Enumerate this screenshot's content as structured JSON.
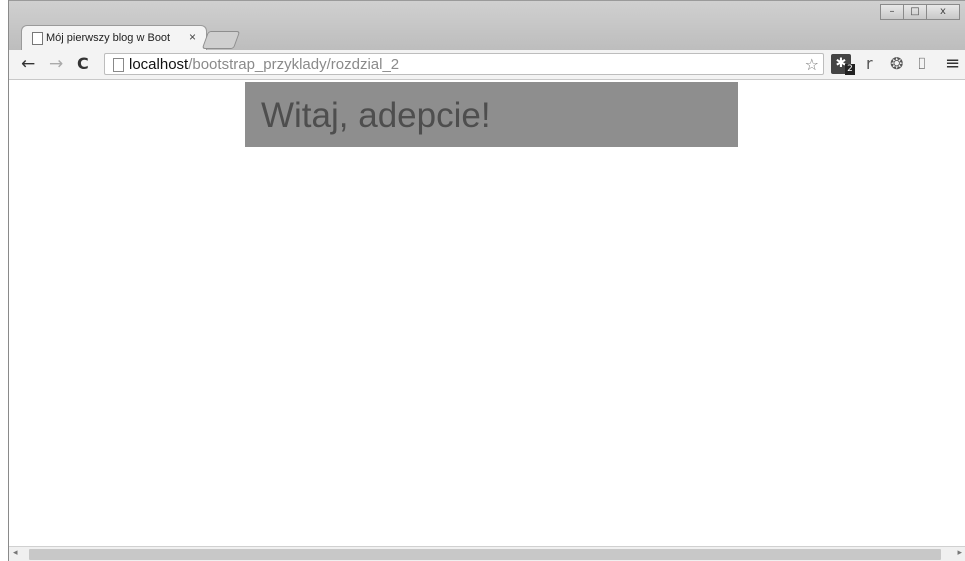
{
  "window": {
    "controls": {
      "minimize": "–",
      "maximize": "□",
      "close": "x"
    }
  },
  "tabs": [
    {
      "title": "Mój pierwszy blog w Boot",
      "close": "×",
      "icon": "page-icon"
    }
  ],
  "toolbar": {
    "back": "←",
    "forward": "→",
    "reload": "C",
    "url_host": "localhost",
    "url_path": "/bootstrap_przyklady/rozdzial_2",
    "bookmark_star": "☆",
    "extensions": [
      {
        "name": "extension-badge-icon",
        "glyph": "✱",
        "badge": "2"
      },
      {
        "name": "r-extension-icon",
        "glyph": "r"
      },
      {
        "name": "chrome-extension-icon",
        "glyph": "❂"
      },
      {
        "name": "cast-icon",
        "glyph": "⌷"
      },
      {
        "name": "menu-icon",
        "glyph": "≡"
      }
    ]
  },
  "page": {
    "jumbotron": {
      "heading": "Witaj, adepcie!"
    }
  },
  "colors": {
    "jumbotron_bg": "#8e8e8e",
    "heading_color": "#4e4e4e"
  }
}
